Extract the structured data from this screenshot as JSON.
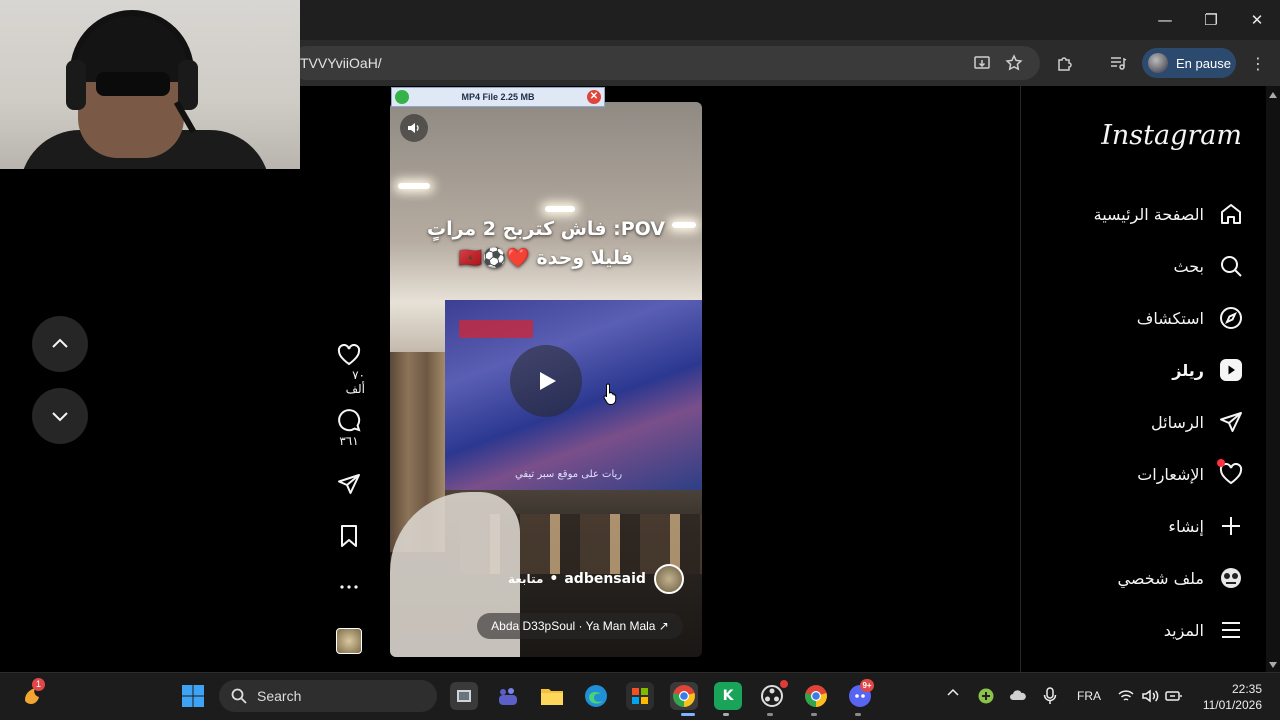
{
  "browser": {
    "url": "TVVYviiOaH/",
    "profile_label": "En pause"
  },
  "download_overlay": {
    "label": "MP4 File 2.25 MB"
  },
  "reel": {
    "caption_line1": "POV: فاش كتربح 2 مراتٍ",
    "caption_line2": "فليلا وحدة ❤️⚽🇲🇦",
    "embedded_ticker": "ريات على موقع سبر تيفي",
    "username": "adbensaid",
    "separator": "•",
    "follow_label": "متابعة",
    "audio": "Abda   D33pSoul · Ya Man Mala ↗"
  },
  "actions": {
    "likes": "٧٠ ألف",
    "comments": "٣٦١"
  },
  "sidebar": {
    "logo": "Instagram",
    "items": [
      {
        "label": "الصفحة الرئيسية",
        "icon": "home-icon"
      },
      {
        "label": "بحث",
        "icon": "search-icon"
      },
      {
        "label": "استكشاف",
        "icon": "compass-icon"
      },
      {
        "label": "ريلز",
        "icon": "reels-icon"
      },
      {
        "label": "الرسائل",
        "icon": "send-icon"
      },
      {
        "label": "الإشعارات",
        "icon": "heart-icon"
      },
      {
        "label": "إنشاء",
        "icon": "plus-icon"
      },
      {
        "label": "ملف شخصي",
        "icon": "avatar-icon"
      },
      {
        "label": "المزيد",
        "icon": "menu-icon"
      }
    ]
  },
  "taskbar": {
    "search_label": "Search",
    "notification_badge": "1",
    "chat_badge": "9+",
    "language": "FRA",
    "time": "22:35",
    "date": "11/01/2026"
  },
  "colors": {
    "accent_notification": "#ff3040",
    "profile_chip": "#2c4a6e"
  }
}
